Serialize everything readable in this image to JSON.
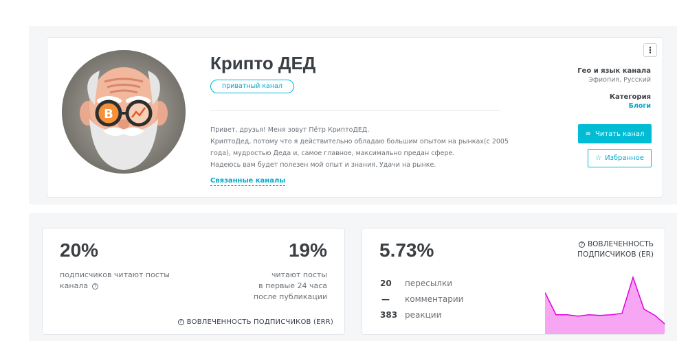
{
  "profile": {
    "title": "Крипто ДЕД",
    "badge": "приватный канал",
    "description": [
      "Привет, друзья! Меня зовут Пётр КриптоДЕД.",
      "КриптоДед, потому что я действительно обладаю большим опытом на рынках(с 2005",
      "года), мудростью Деда и, самое главное, максимально предан сфере.",
      "Надеюсь вам будет полезен мой опыт и знания. Удачи на рынке."
    ],
    "related_link": "Связанные каналы"
  },
  "sidebar": {
    "geo_label": "Гео и язык канала",
    "geo_value": "Эфиопия, Русский",
    "category_label": "Категория",
    "category_value": "Блоги",
    "read_button": "Читать канал",
    "fav_button": "Избранное",
    "menu_glyph": "⋮"
  },
  "err_card": {
    "left_value": "20%",
    "left_text_line1": "подписчиков читают посты",
    "left_text_line2": "канала",
    "right_value": "19%",
    "right_text_line1": "читают посты",
    "right_text_line2": "в первые 24 часа",
    "right_text_line3": "после публикации",
    "footer": "ВОВЛЕЧЕННОСТЬ ПОДПИСЧИКОВ (ERR)"
  },
  "er_card": {
    "value": "5.73%",
    "title_line1": "ВОВЛЕЧЕННОСТЬ",
    "title_line2": "ПОДПИСЧИКОВ (ER)",
    "stats": [
      {
        "num": "20",
        "label": "пересылки"
      },
      {
        "num": "—",
        "label": "комментарии"
      },
      {
        "num": "383",
        "label": "реакции"
      }
    ]
  },
  "icons": {
    "question": "?",
    "read": "≡",
    "star": "☆"
  },
  "colors": {
    "accent": "#00bcd4",
    "spark_line": "#e000e0",
    "spark_fill": "#f7a6f3"
  },
  "sparkline": [
    0.62,
    0.3,
    0.3,
    0.28,
    0.3,
    0.29,
    0.3,
    0.32,
    0.84,
    0.38,
    0.29,
    0.15
  ]
}
